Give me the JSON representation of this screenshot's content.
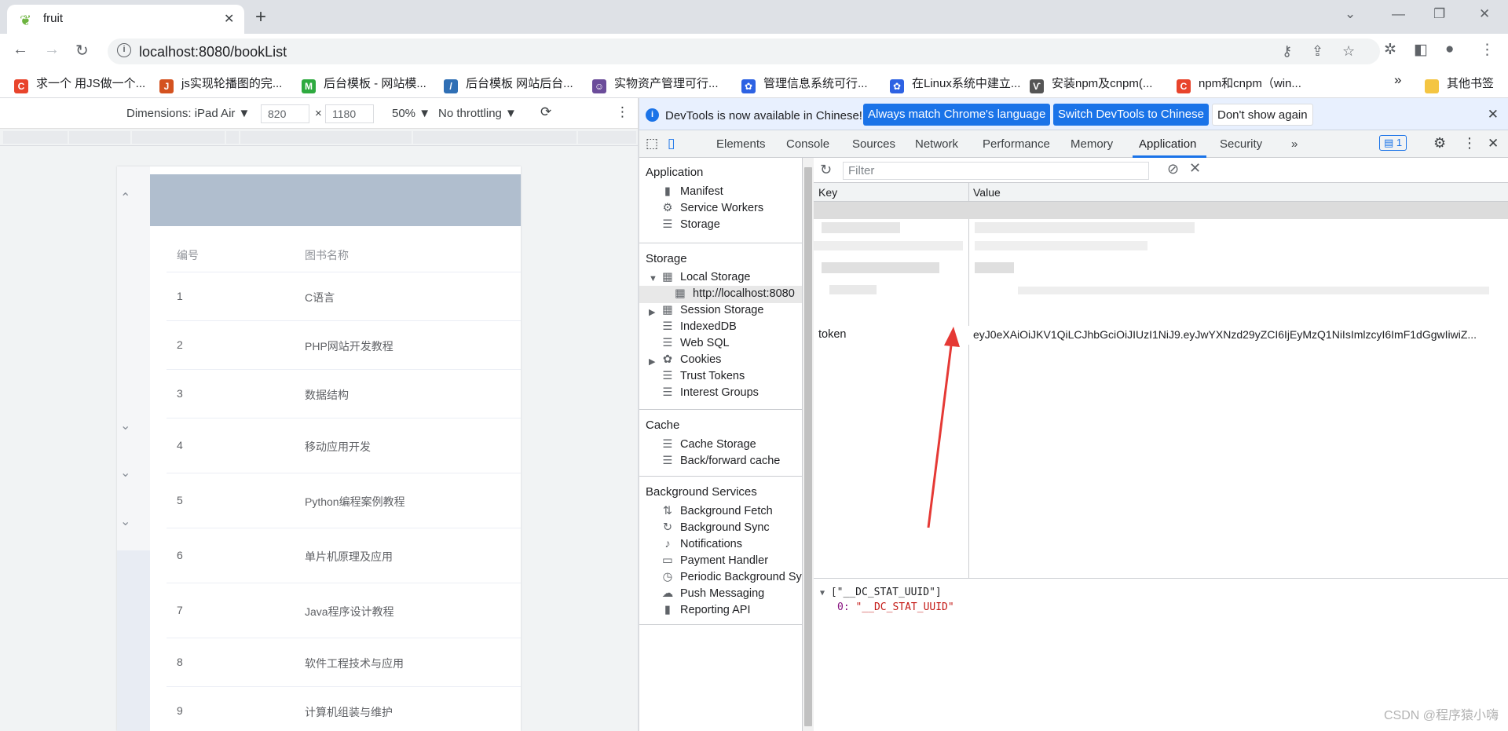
{
  "browser": {
    "tab_title": "fruit",
    "url": "localhost:8080/bookList",
    "bookmarks": [
      {
        "label": "求一个 用JS做一个...",
        "color": "#e8442c",
        "glyph": "C"
      },
      {
        "label": "js实现轮播图的完...",
        "color": "#d4521f",
        "glyph": "J"
      },
      {
        "label": "后台模板 - 网站模...",
        "color": "#2eaa3f",
        "glyph": "M"
      },
      {
        "label": "后台模板 网站后台...",
        "color": "#2f6fb5",
        "glyph": "/"
      },
      {
        "label": "实物资产管理可行...",
        "color": "#6b4c9a",
        "glyph": "☺"
      },
      {
        "label": "管理信息系统可行...",
        "color": "#2d62e3",
        "glyph": "✿"
      },
      {
        "label": "在Linux系统中建立...",
        "color": "#2d62e3",
        "glyph": "✿"
      },
      {
        "label": "安装npm及cnpm(...",
        "color": "#555555",
        "glyph": "Ѵ"
      },
      {
        "label": "npm和cnpm（win...",
        "color": "#e8442c",
        "glyph": "C"
      }
    ],
    "bookmarks_more": "»",
    "other_bookmarks": "其他书签"
  },
  "device_toolbar": {
    "dimensions": "Dimensions: iPad Air ▼",
    "width": "820",
    "times": "×",
    "height": "1180",
    "zoom": "50% ▼",
    "throttling": "No throttling ▼"
  },
  "page": {
    "columns": [
      "编号",
      "图书名称"
    ],
    "rows": [
      [
        "1",
        "C语言"
      ],
      [
        "2",
        "PHP网站开发教程"
      ],
      [
        "3",
        "数据结构"
      ],
      [
        "4",
        "移动应用开发"
      ],
      [
        "5",
        "Python编程案例教程"
      ],
      [
        "6",
        "单片机原理及应用"
      ],
      [
        "7",
        "Java程序设计教程"
      ],
      [
        "8",
        "软件工程技术与应用"
      ],
      [
        "9",
        "计算机组装与维护"
      ]
    ]
  },
  "devtools": {
    "info_message": "DevTools is now available in Chinese!",
    "btn_match": "Always match Chrome's language",
    "btn_switch": "Switch DevTools to Chinese",
    "btn_dont": "Don't show again",
    "tabs": [
      "Elements",
      "Console",
      "Sources",
      "Network",
      "Performance",
      "Memory",
      "Application",
      "Security"
    ],
    "more_tabs": "»",
    "issues_count": "1",
    "sidebar": {
      "application_header": "Application",
      "application_items": [
        "Manifest",
        "Service Workers",
        "Storage"
      ],
      "storage_header": "Storage",
      "local_storage": "Local Storage",
      "local_origin": "http://localhost:8080",
      "session_storage": "Session Storage",
      "storage_items": [
        "IndexedDB",
        "Web SQL",
        "Cookies",
        "Trust Tokens",
        "Interest Groups"
      ],
      "cache_header": "Cache",
      "cache_items": [
        "Cache Storage",
        "Back/forward cache"
      ],
      "bg_header": "Background Services",
      "bg_items": [
        "Background Fetch",
        "Background Sync",
        "Notifications",
        "Payment Handler",
        "Periodic Background Sy",
        "Push Messaging",
        "Reporting API"
      ]
    },
    "filter_placeholder": "Filter",
    "col_key": "Key",
    "col_value": "Value",
    "token_key": "token",
    "token_value": "eyJ0eXAiOiJKV1QiLCJhbGciOiJIUzI1NiJ9.eyJwYXNzd29yZCI6IjEyMzQ1NiIsImlzcyI6ImF1dGgwIiwiZ...",
    "preview_line1": "[\"__DC_STAT_UUID\"]",
    "preview_index": "0:",
    "preview_value": "\"__DC_STAT_UUID\""
  },
  "watermark": "CSDN @程序猿小嗨",
  "colors": {
    "accent": "#1a73e8",
    "arrow": "#e53935"
  }
}
